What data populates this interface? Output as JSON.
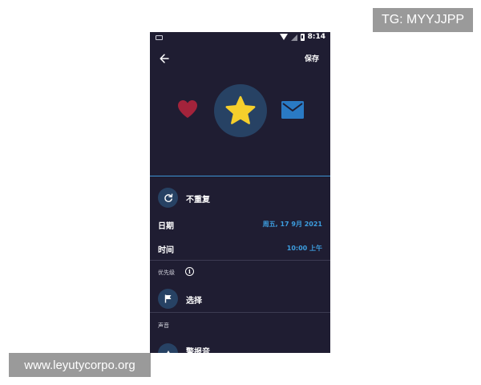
{
  "watermarks": {
    "top": "TG: MYYJJPP",
    "bottom": "www.leyutycorpo.org"
  },
  "status_bar": {
    "time": "8:14"
  },
  "header": {
    "back_icon": "arrow-left-icon",
    "save_label": "保存"
  },
  "icon_picker": {
    "items": [
      {
        "icon": "heart-icon",
        "color": "#a3233b"
      },
      {
        "icon": "star-icon",
        "color": "#f5cf2c",
        "selected": true
      },
      {
        "icon": "mail-icon",
        "color": "#2a7ac4"
      }
    ]
  },
  "repeat": {
    "icon": "refresh-icon",
    "label": "不重复"
  },
  "date": {
    "label": "日期",
    "value": "周五, 17 9月 2021"
  },
  "time": {
    "label": "时间",
    "value": "10:00 上午"
  },
  "priority": {
    "section_label": "优先级",
    "info_icon": "info-icon",
    "icon": "flag-icon",
    "label": "选择"
  },
  "sound": {
    "section_label": "声音",
    "label": "警报音"
  },
  "colors": {
    "background": "#1f1d32",
    "accent": "#3d9ee0",
    "icon_circle": "#274264"
  }
}
